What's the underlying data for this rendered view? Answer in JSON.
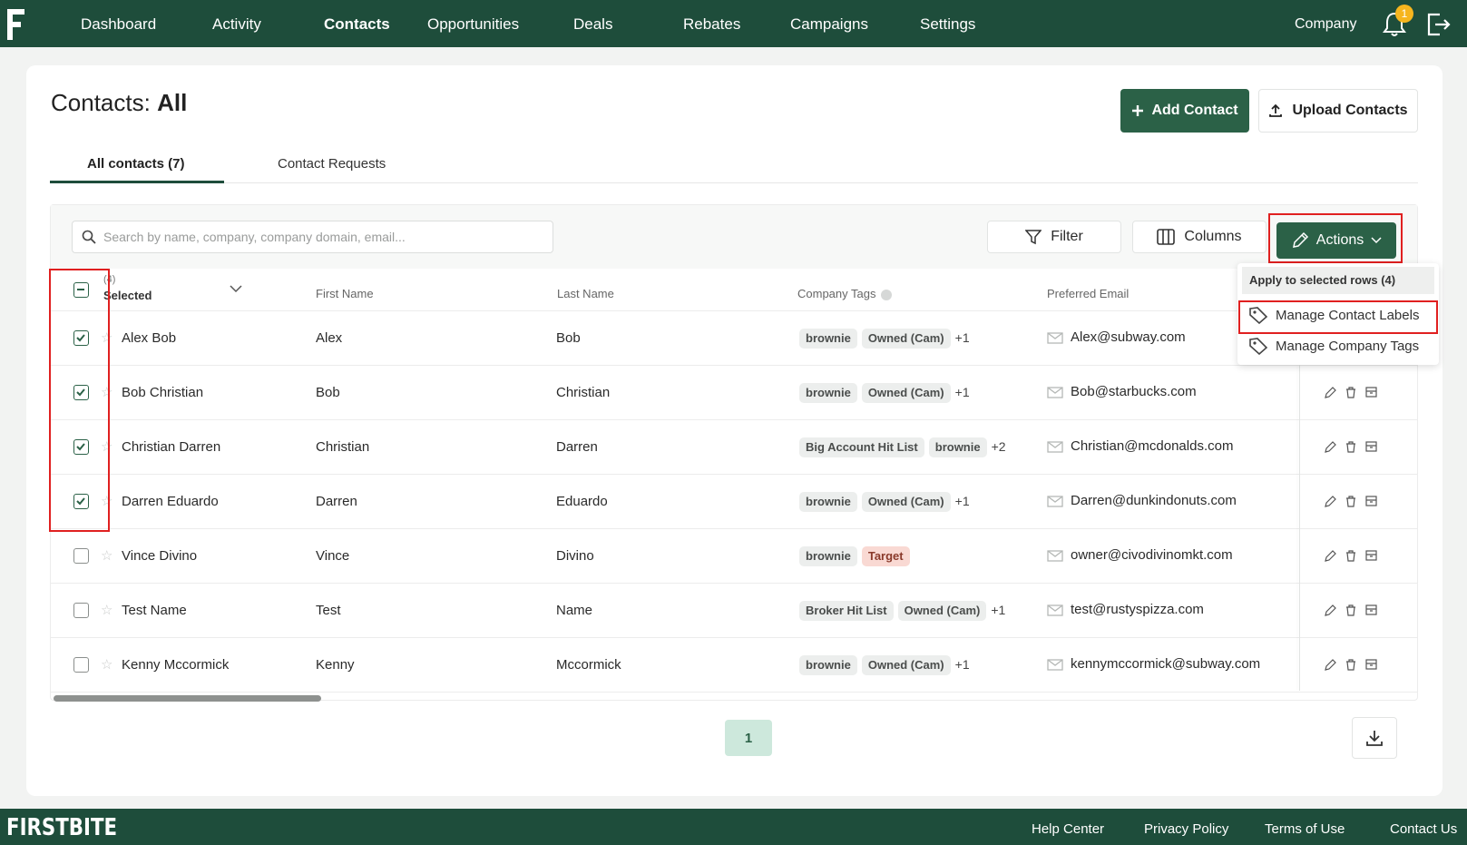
{
  "nav": {
    "items": [
      {
        "label": "Dashboard",
        "active": false
      },
      {
        "label": "Activity",
        "active": false
      },
      {
        "label": "Contacts",
        "active": true
      },
      {
        "label": "Opportunities",
        "active": false
      },
      {
        "label": "Deals",
        "active": false
      },
      {
        "label": "Rebates",
        "active": false
      },
      {
        "label": "Campaigns",
        "active": false
      },
      {
        "label": "Settings",
        "active": false
      }
    ],
    "company": "Company",
    "notification_count": "1"
  },
  "page": {
    "title_prefix": "Contacts:",
    "title_strong": "All",
    "add_contact": "Add Contact",
    "upload_contacts": "Upload Contacts"
  },
  "tabs": {
    "all": "All contacts (7)",
    "requests": "Contact Requests"
  },
  "toolbar": {
    "search_placeholder": "Search by name, company, company domain, email...",
    "filter": "Filter",
    "columns": "Columns",
    "actions": "Actions"
  },
  "table": {
    "selected_count": "(4)",
    "selected_label": "Selected",
    "headers": {
      "first_name": "First Name",
      "last_name": "Last Name",
      "company_tags": "Company Tags",
      "preferred_email": "Preferred Email"
    },
    "rows": [
      {
        "checked": true,
        "full": "Alex Bob",
        "first": "Alex",
        "last": "Bob",
        "tags": [
          "brownie",
          "Owned (Cam)"
        ],
        "more": "+1",
        "email": "Alex@subway.com"
      },
      {
        "checked": true,
        "full": "Bob Christian",
        "first": "Bob",
        "last": "Christian",
        "tags": [
          "brownie",
          "Owned (Cam)"
        ],
        "more": "+1",
        "email": "Bob@starbucks.com"
      },
      {
        "checked": true,
        "full": "Christian Darren",
        "first": "Christian",
        "last": "Darren",
        "tags": [
          "Big Account Hit List",
          "brownie"
        ],
        "more": "+2",
        "email": "Christian@mcdonalds.com"
      },
      {
        "checked": true,
        "full": "Darren Eduardo",
        "first": "Darren",
        "last": "Eduardo",
        "tags": [
          "brownie",
          "Owned (Cam)"
        ],
        "more": "+1",
        "email": "Darren@dunkindonuts.com"
      },
      {
        "checked": false,
        "full": "Vince Divino",
        "first": "Vince",
        "last": "Divino",
        "tags": [
          "brownie",
          "Target"
        ],
        "more": "",
        "email": "owner@civodivinomkt.com"
      },
      {
        "checked": false,
        "full": "Test Name",
        "first": "Test",
        "last": "Name",
        "tags": [
          "Broker Hit List",
          "Owned (Cam)"
        ],
        "more": "+1",
        "email": "test@rustyspizza.com"
      },
      {
        "checked": false,
        "full": "Kenny Mccormick",
        "first": "Kenny",
        "last": "Mccormick",
        "tags": [
          "brownie",
          "Owned (Cam)"
        ],
        "more": "+1",
        "email": "kennymccormick@subway.com"
      }
    ]
  },
  "dropdown": {
    "header": "Apply to selected rows (4)",
    "items": [
      "Manage Contact Labels",
      "Manage Company Tags"
    ]
  },
  "pagination": {
    "current": "1"
  },
  "footer": {
    "logo": "FIRSTBITE",
    "links": [
      "Help Center",
      "Privacy Policy",
      "Terms of Use",
      "Contact Us"
    ]
  },
  "colors": {
    "brand": "#1e4d3b",
    "accent": "#2b6147",
    "highlight": "#e02020"
  }
}
